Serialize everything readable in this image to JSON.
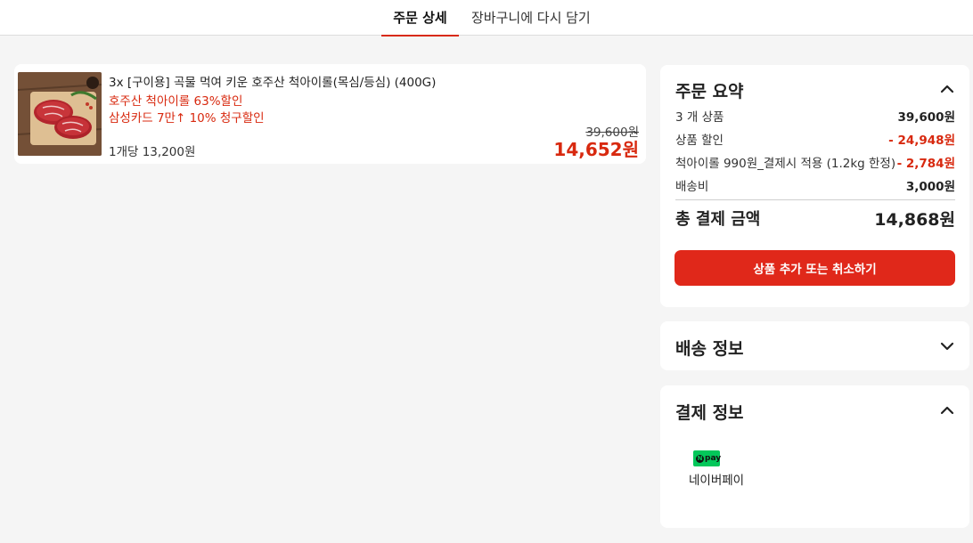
{
  "tabs": {
    "active": "주문 상세",
    "reorder": "장바구니에 다시 담기"
  },
  "item": {
    "name": "3x [구이용] 곡물 먹여 키운 호주산 척아이롤(목심/등심) (400G)",
    "promo_1": "호주산 척아이롤 63%할인",
    "promo_2": "삼성카드 7만↑ 10% 청구할인",
    "unit_price": "1개당 13,200원",
    "original_price": "39,600원",
    "final_price": "14,652원"
  },
  "summary": {
    "title": "주문 요약",
    "rows": [
      {
        "label": "3 개 상품",
        "value": "39,600원"
      },
      {
        "label": "상품 할인",
        "value": "- 24,948원"
      },
      {
        "label": "척아이롤 990원_결제시 적용 (1.2kg 한정)",
        "value": "- 2,784원"
      },
      {
        "label": "배송비",
        "value": "3,000원"
      }
    ],
    "total_label": "총 결제 금액",
    "total_value": "14,868원",
    "cta_label": "상품 추가 또는 취소하기"
  },
  "delivery": {
    "title": "배송 정보"
  },
  "payment": {
    "title": "결제 정보",
    "method_label": "네이버페이",
    "badge_n": "N",
    "badge_text": "pay"
  },
  "colors": {
    "accent": "#e0281a",
    "discount": "#d8290f",
    "npay_green": "#03c75a",
    "background": "#f5f5f5"
  },
  "icons": {
    "summary_toggle": "chevron-up-icon",
    "delivery_toggle": "chevron-down-icon",
    "payment_toggle": "chevron-up-icon"
  }
}
